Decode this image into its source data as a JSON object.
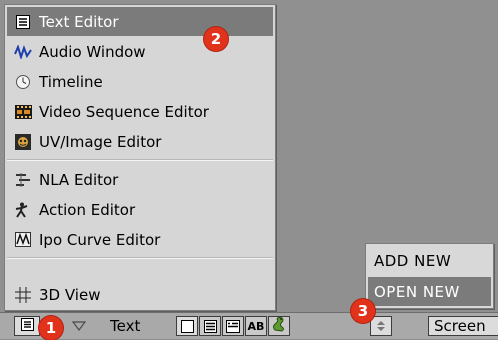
{
  "menu": {
    "items": [
      {
        "label": "Text Editor",
        "icon": "text-editor-icon"
      },
      {
        "label": "Audio Window",
        "icon": "audio-window-icon"
      },
      {
        "label": "Timeline",
        "icon": "timeline-icon"
      },
      {
        "label": "Video Sequence Editor",
        "icon": "video-sequence-icon"
      },
      {
        "label": "UV/Image Editor",
        "icon": "uv-image-icon"
      },
      {
        "label": "NLA Editor",
        "icon": "nla-editor-icon"
      },
      {
        "label": "Action Editor",
        "icon": "action-editor-icon"
      },
      {
        "label": "Ipo Curve Editor",
        "icon": "ipo-curve-icon"
      },
      {
        "label": "3D View",
        "icon": "3d-view-icon"
      }
    ],
    "active_index": 0
  },
  "popup": {
    "items": [
      {
        "label": "ADD NEW"
      },
      {
        "label": "OPEN NEW"
      }
    ],
    "active_index": 1
  },
  "header": {
    "menu_label": "Text",
    "screen_label": "Screen"
  },
  "markers": [
    "1",
    "2",
    "3"
  ],
  "colors": {
    "marker": "#e1331c",
    "highlight": "#7b7b7b",
    "menu_bg": "#d6d6d6",
    "viewport_bg": "#909090"
  }
}
